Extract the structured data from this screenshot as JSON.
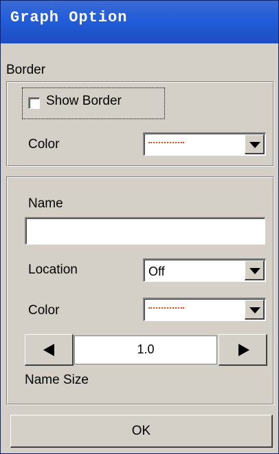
{
  "window": {
    "title": "Graph Option"
  },
  "border_section": {
    "heading": "Border",
    "show_border": {
      "label": "Show Border",
      "checked": false
    },
    "color": {
      "label": "Color",
      "value_style": "dashed-line",
      "value_color": "#ff4000"
    }
  },
  "name_section": {
    "name": {
      "label": "Name",
      "value": ""
    },
    "location": {
      "label": "Location",
      "value": "Off"
    },
    "color": {
      "label": "Color",
      "value_style": "dashed-line",
      "value_color": "#ff4000"
    },
    "size": {
      "value": "1.0",
      "label": "Name Size"
    }
  },
  "footer": {
    "ok_label": "OK"
  },
  "icons": {
    "dropdown": "chevron-down-icon",
    "decrement": "arrow-left-icon",
    "increment": "arrow-right-icon"
  }
}
